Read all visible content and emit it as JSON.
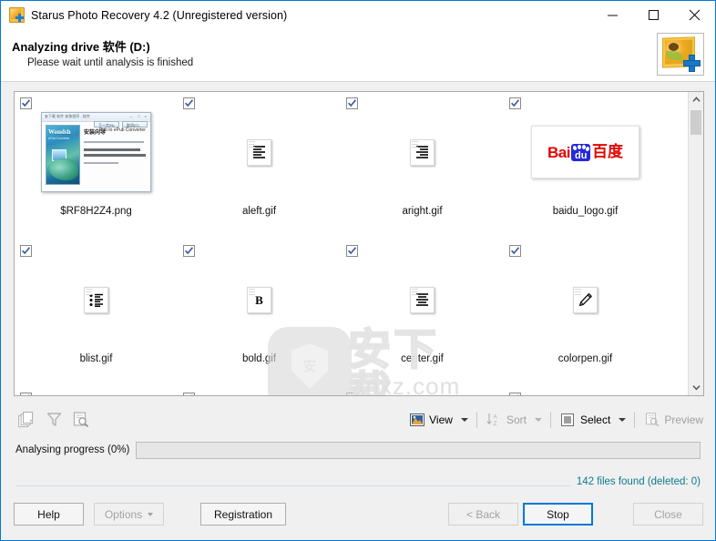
{
  "window": {
    "title": "Starus Photo Recovery 4.2 (Unregistered version)",
    "app_icon": "photo-recovery-icon",
    "controls": {
      "minimize": "minimize-icon",
      "maximize": "maximize-icon",
      "close": "close-icon"
    }
  },
  "header": {
    "title_prefix": "Analyzing drive ",
    "title_drive": "软件",
    "title_suffix": " (D:)",
    "subtitle": "Please wait until analysis is finished",
    "logo": "starus-photo-recovery-logo"
  },
  "grid": {
    "rows": [
      {
        "cells": [
          {
            "checked": true,
            "filename": "$RF8H2Z4.png",
            "thumb": "screenshot",
            "shot": {
              "titlebar": "安下载 软件 安装程序 - 软件",
              "title_controls": "— □ ×",
              "cover_title": "Wondsh",
              "cover_sub": "eFub Converter",
              "heading": "安装向导",
              "heading2": "Pub to ePub Converter",
              "button1": "下一步(N)",
              "button2": "取消(C)"
            }
          },
          {
            "checked": true,
            "filename": "aleft.gif",
            "thumb": "align-left-icon"
          },
          {
            "checked": true,
            "filename": "aright.gif",
            "thumb": "align-right-icon"
          },
          {
            "checked": true,
            "filename": "baidu_logo.gif",
            "thumb": "baidu-logo",
            "baidu": {
              "bai": "Bai",
              "du": "du",
              "cn": "百度",
              "red": "#e10602",
              "blue": "#2529d8"
            }
          }
        ]
      },
      {
        "cells": [
          {
            "checked": true,
            "filename": "blist.gif",
            "thumb": "bullet-list-icon"
          },
          {
            "checked": true,
            "filename": "bold.gif",
            "thumb": "bold-icon",
            "glyph": "B"
          },
          {
            "checked": true,
            "filename": "center.gif",
            "thumb": "align-center-icon"
          },
          {
            "checked": true,
            "filename": "colorpen.gif",
            "thumb": "color-pen-icon"
          }
        ]
      },
      {
        "cells": [
          {
            "checked": true,
            "filename": "",
            "thumb": ""
          },
          {
            "checked": true,
            "filename": "",
            "thumb": ""
          },
          {
            "checked": true,
            "filename": "",
            "thumb": ""
          },
          {
            "checked": true,
            "filename": "",
            "thumb": ""
          }
        ]
      }
    ],
    "scrollbar": {
      "up": "chevron-up-icon",
      "down": "chevron-down-icon"
    }
  },
  "watermark": {
    "cn": "安下载",
    "domain": "anxz.com",
    "badge_char": "安"
  },
  "toolbar": {
    "left_icons": [
      {
        "name": "duplicates-icon"
      },
      {
        "name": "filter-icon"
      },
      {
        "name": "find-icon"
      }
    ],
    "view_label": "View",
    "sort_label": "Sort",
    "select_label": "Select",
    "preview_label": "Preview"
  },
  "progress": {
    "label": "Analysing progress (0%)",
    "percent": 0,
    "status": "142 files found (deleted: 0)",
    "status_color": "#0b7a8c"
  },
  "buttons": {
    "help": "Help",
    "options": "Options",
    "registration": "Registration",
    "back": "< Back",
    "stop": "Stop",
    "close": "Close"
  }
}
